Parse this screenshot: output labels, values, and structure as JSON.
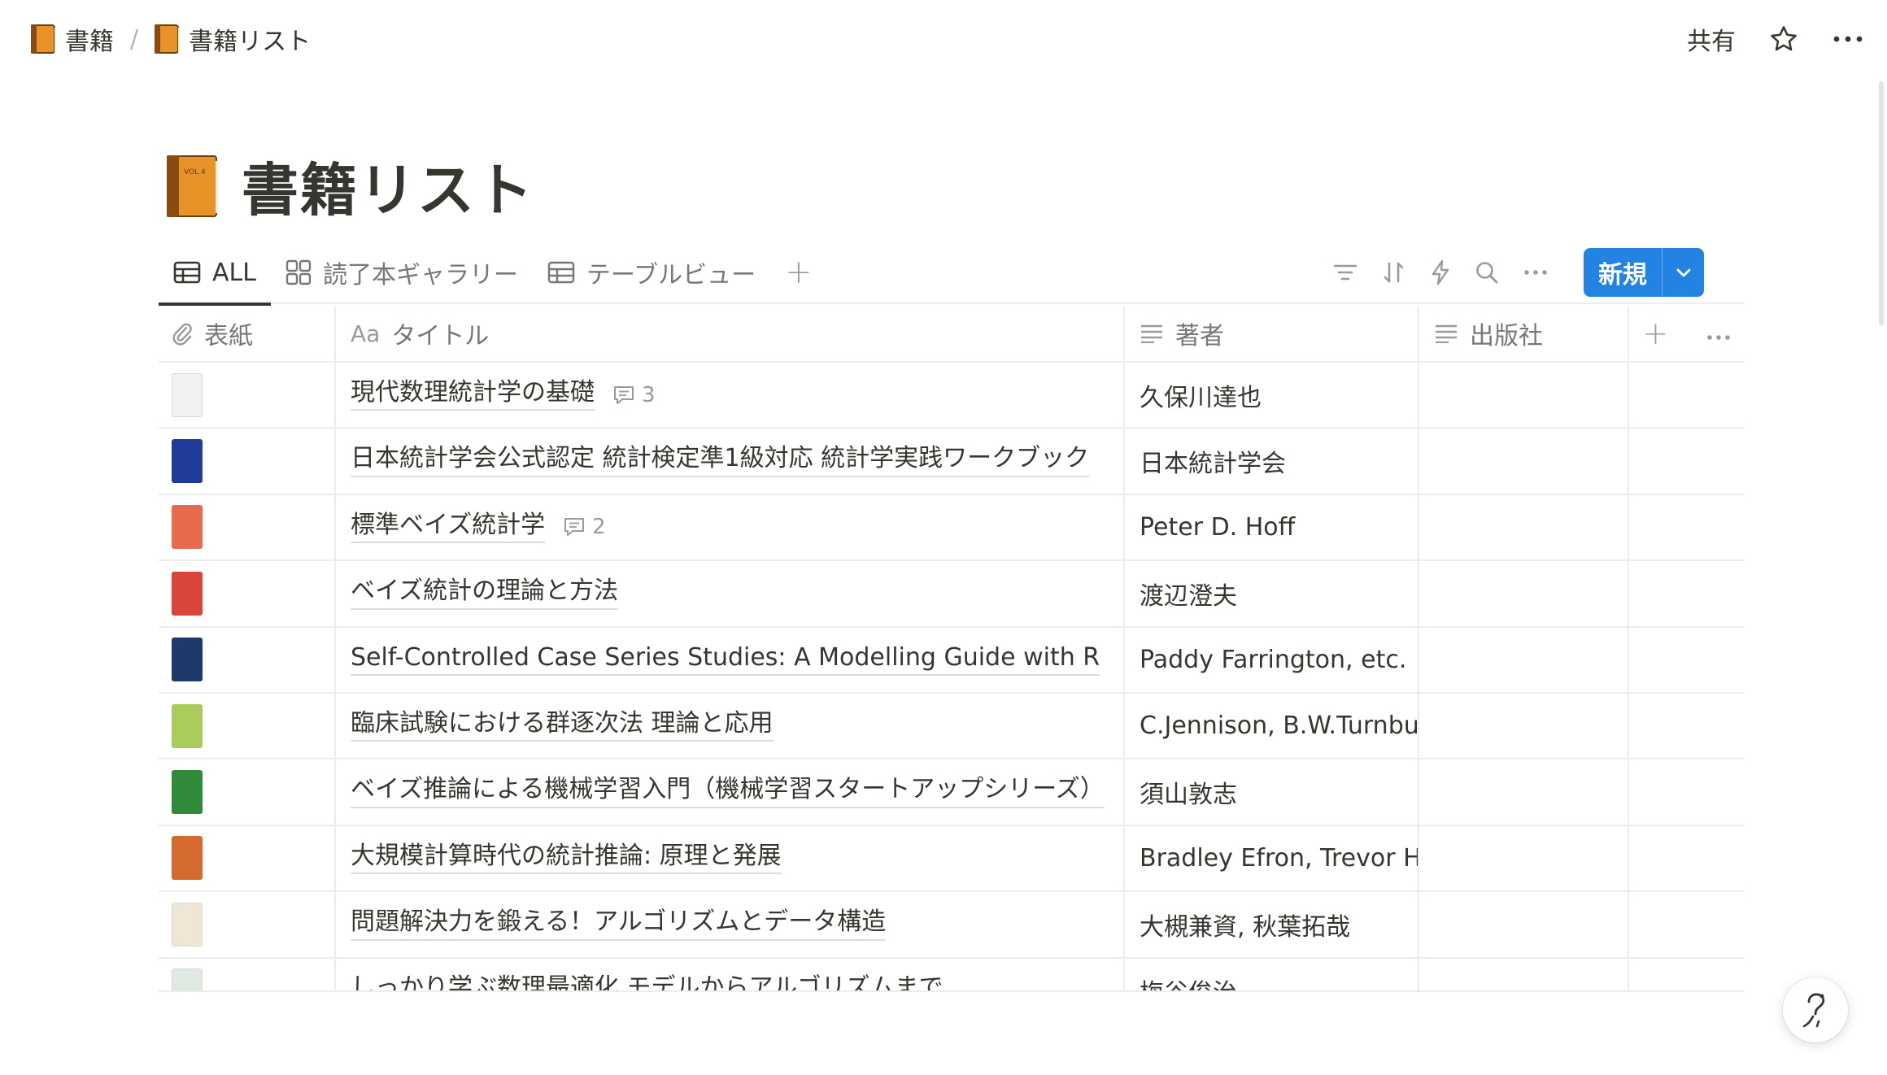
{
  "breadcrumb": {
    "items": [
      {
        "label": "書籍"
      },
      {
        "label": "書籍リスト"
      }
    ],
    "separator": "/"
  },
  "top_actions": {
    "share_label": "共有",
    "favorite_icon": "star-icon",
    "more_icon": "more-horizontal-icon"
  },
  "page": {
    "icon": "orange-book-emoji",
    "icon_label": "VOL 4",
    "title": "書籍リスト"
  },
  "views": {
    "tabs": [
      {
        "label": "ALL",
        "icon": "table-icon",
        "active": true
      },
      {
        "label": "読了本ギャラリー",
        "icon": "gallery-icon",
        "active": false
      },
      {
        "label": "テーブルビュー",
        "icon": "table-icon",
        "active": false
      }
    ],
    "add_label": "+",
    "tools": [
      "filter-icon",
      "sort-icon",
      "automation-icon",
      "search-icon",
      "more-horizontal-icon"
    ],
    "new_button_label": "新規"
  },
  "table": {
    "columns": [
      {
        "label": "表紙",
        "icon": "paperclip-icon"
      },
      {
        "label": "タイトル",
        "icon_text": "Aa"
      },
      {
        "label": "著者",
        "icon": "text-lines-icon"
      },
      {
        "label": "出版社",
        "icon": "text-lines-icon"
      }
    ],
    "add_column_label": "+",
    "rows": [
      {
        "title": "現代数理統計学の基礎",
        "comments": "3",
        "author": "久保川達也",
        "publisher": "",
        "cover_color": "#f1f1ef"
      },
      {
        "title": "日本統計学会公式認定 統計検定準1級対応 統計学実践ワークブック",
        "comments": "",
        "author": "日本統計学会",
        "publisher": "",
        "cover_color": "#1f3c9a"
      },
      {
        "title": "標準ベイズ統計学",
        "comments": "2",
        "author": "Peter D. Hoff",
        "publisher": "",
        "cover_color": "#e86a4c"
      },
      {
        "title": "ベイズ統計の理論と方法",
        "comments": "",
        "author": "渡辺澄夫",
        "publisher": "",
        "cover_color": "#d9453a"
      },
      {
        "title": "Self-Controlled Case Series Studies: A Modelling Guide with R",
        "comments": "",
        "author": "Paddy Farrington, etc.",
        "publisher": "",
        "cover_color": "#1e3a6a"
      },
      {
        "title": "臨床試験における群逐次法 理論と応用",
        "comments": "",
        "author": "C.Jennison, B.W.Turnbull",
        "publisher": "",
        "cover_color": "#a9cc5a"
      },
      {
        "title": "ベイズ推論による機械学習入門（機械学習スタートアップシリーズ）",
        "comments": "",
        "author": "須山敦志",
        "publisher": "",
        "cover_color": "#2f8a3c"
      },
      {
        "title": "大規模計算時代の統計推論: 原理と発展",
        "comments": "",
        "author": "Bradley Efron, Trevor Ha",
        "publisher": "",
        "cover_color": "#d46a2e"
      },
      {
        "title": "問題解決力を鍛える！アルゴリズムとデータ構造",
        "comments": "",
        "author": "大槻兼資, 秋葉拓哉",
        "publisher": "",
        "cover_color": "#f0e6d6"
      },
      {
        "title": "しっかり学ぶ数理最適化 モデルからアルゴリズムまで",
        "comments": "",
        "author": "梅谷俊治",
        "publisher": "",
        "cover_color": "#dfe8e1"
      }
    ]
  },
  "help_icon": "help-question-icon"
}
